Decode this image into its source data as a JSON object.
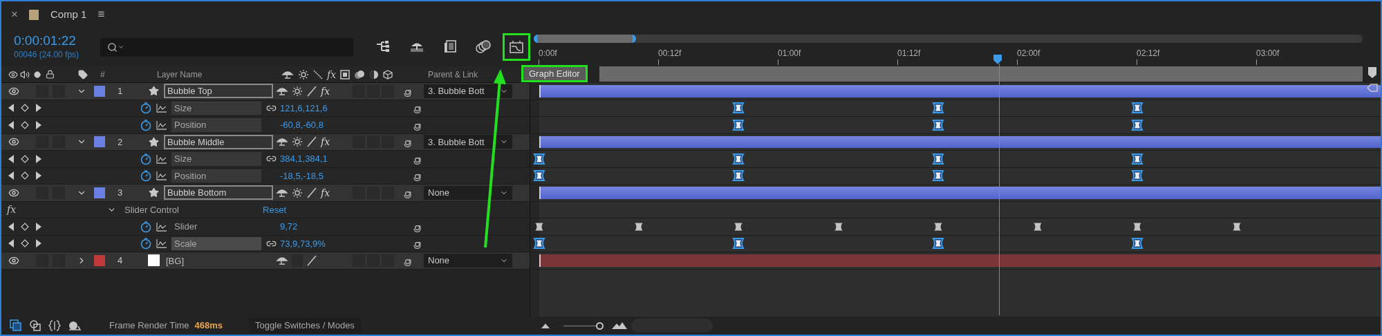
{
  "tab": {
    "close": "×",
    "color": "#b5a27a",
    "title": "Comp 1",
    "menu": "≡"
  },
  "timecode": "0:00:01:22",
  "frame_info": "00046 (24.00 fps)",
  "toolbar": [
    {
      "kind": "flowchart",
      "highlighted": false
    },
    {
      "kind": "shy",
      "highlighted": false
    },
    {
      "kind": "frame-blend",
      "highlighted": false
    },
    {
      "kind": "motion-blur",
      "highlighted": false
    },
    {
      "kind": "graph-editor",
      "highlighted": true
    }
  ],
  "columns": {
    "number": "#",
    "name": "Layer Name",
    "fx": "fx",
    "parent": "Parent & Link"
  },
  "ruler": [
    "0:00f",
    "00:12f",
    "01:00f",
    "01:12f",
    "02:00f",
    "02:12f",
    "03:00f"
  ],
  "graph_editor_label": {
    "text": "Graph Editor",
    "highlighted": true
  },
  "rows": [
    {
      "kind": "shape_layer",
      "number": "1",
      "name": "Bubble Top",
      "color": "#6b7fe3",
      "fx": "fx",
      "effects_on": true,
      "expanded": true,
      "parent": "3. Bubble Bott"
    },
    {
      "kind": "property",
      "name": "Size",
      "value": "121,6,121,6",
      "linked": true,
      "selected": false,
      "key_slots": [
        false,
        false,
        true,
        false,
        true,
        false,
        true,
        false
      ],
      "keys_selected": true
    },
    {
      "kind": "property",
      "name": "Position",
      "value": "-60,8,-60,8",
      "linked": false,
      "selected": false,
      "key_slots": [
        false,
        false,
        true,
        false,
        true,
        false,
        true,
        false
      ],
      "keys_selected": true
    },
    {
      "kind": "shape_layer",
      "number": "2",
      "name": "Bubble Middle",
      "color": "#6b7fe3",
      "fx": "fx",
      "effects_on": true,
      "expanded": true,
      "parent": "3. Bubble Bott"
    },
    {
      "kind": "property",
      "name": "Size",
      "value": "384,1,384,1",
      "linked": true,
      "selected": false,
      "key_slots": [
        true,
        false,
        true,
        false,
        true,
        false,
        true,
        false
      ],
      "keys_selected": true
    },
    {
      "kind": "property",
      "name": "Position",
      "value": "-18,5,-18,5",
      "linked": false,
      "selected": false,
      "key_slots": [
        true,
        false,
        true,
        false,
        true,
        false,
        true,
        false
      ],
      "keys_selected": true
    },
    {
      "kind": "shape_layer",
      "number": "3",
      "name": "Bubble Bottom",
      "color": "#6b7fe3",
      "fx": "fx",
      "effects_on": true,
      "expanded": true,
      "parent": "None"
    },
    {
      "kind": "effect",
      "fx": "fx",
      "name": "Slider Control",
      "action": "Reset"
    },
    {
      "kind": "effect_property",
      "name": "Slider",
      "value": "9,72",
      "key_slots": [
        true,
        true,
        true,
        true,
        true,
        true,
        true,
        true
      ],
      "keys_selected": false
    },
    {
      "kind": "property",
      "name": "Scale",
      "value": "73,9,73,9%",
      "linked": true,
      "selected": true,
      "key_slots": [
        true,
        false,
        true,
        false,
        true,
        false,
        true,
        false
      ],
      "keys_selected": true
    },
    {
      "kind": "solid_layer",
      "number": "4",
      "name": "[BG]",
      "color": "#c0393b",
      "expanded": false,
      "parent": "None"
    }
  ],
  "status": {
    "label": "Frame Render Time",
    "value": "468ms",
    "toggle": "Toggle Switches / Modes"
  },
  "zoom": {
    "level": 1
  }
}
